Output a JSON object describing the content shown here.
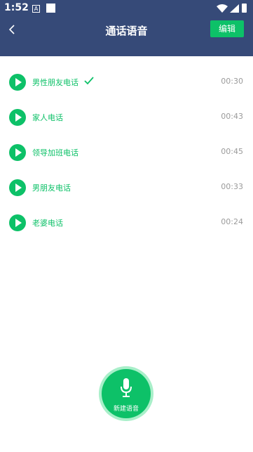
{
  "status": {
    "time": "1:52",
    "a_glyph": "A"
  },
  "header": {
    "title": "通话语音",
    "edit_label": "编辑"
  },
  "items": [
    {
      "label": "男性朋友电话",
      "duration": "00:30",
      "selected": true
    },
    {
      "label": "家人电话",
      "duration": "00:43",
      "selected": false
    },
    {
      "label": "领导加班电话",
      "duration": "00:45",
      "selected": false
    },
    {
      "label": "男朋友电话",
      "duration": "00:33",
      "selected": false
    },
    {
      "label": "老婆电话",
      "duration": "00:24",
      "selected": false
    }
  ],
  "record": {
    "label": "新建语音"
  },
  "colors": {
    "header": "#364a78",
    "accent": "#0dc168",
    "accent_light": "#a8efc9",
    "duration": "#9a9a9a"
  }
}
